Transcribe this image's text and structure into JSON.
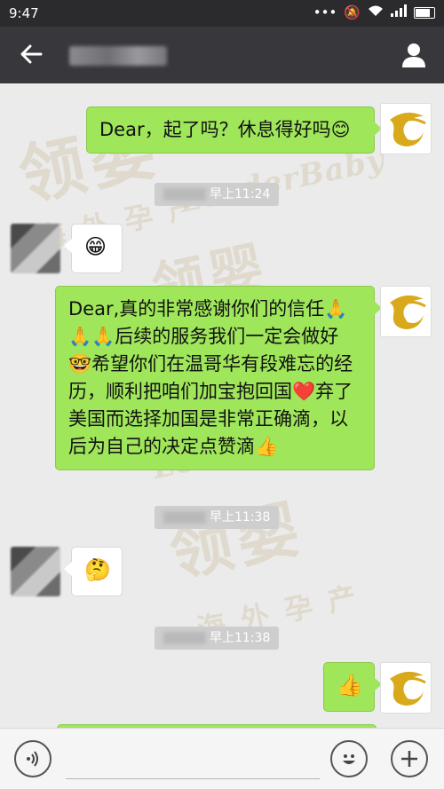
{
  "status_bar": {
    "time": "9:47"
  },
  "chat": {
    "messages": [
      {
        "side": "right",
        "text": "Dear，起了吗？休息得好吗😊"
      },
      {
        "side": "left",
        "emoji": "😁"
      },
      {
        "side": "right",
        "text": "Dear,真的非常感谢你们的信任🙏🙏🙏后续的服务我们一定会做好🤓希望你们在温哥华有段难忘的经历，顺利把咱们加宝抱回国❤️弃了美国而选择加国是非常正确滴，以后为自己的决定点赞滴👍"
      },
      {
        "side": "left",
        "emoji": "🤔"
      },
      {
        "side": "right",
        "emoji": "👍"
      }
    ],
    "timestamps": [
      "早上11:24",
      "早上11:38",
      "早上11:38"
    ],
    "watermark": {
      "cn": "领婴",
      "en": "LeaderBaby",
      "sub": "海外孕产"
    }
  },
  "colors": {
    "bubble_green": "#9fe65a",
    "nav_bg": "#38383c",
    "status_bg": "#2b2b2e"
  },
  "icons": [
    "back-arrow-icon",
    "profile-icon",
    "voice-icon",
    "emoji-icon",
    "plus-icon"
  ]
}
